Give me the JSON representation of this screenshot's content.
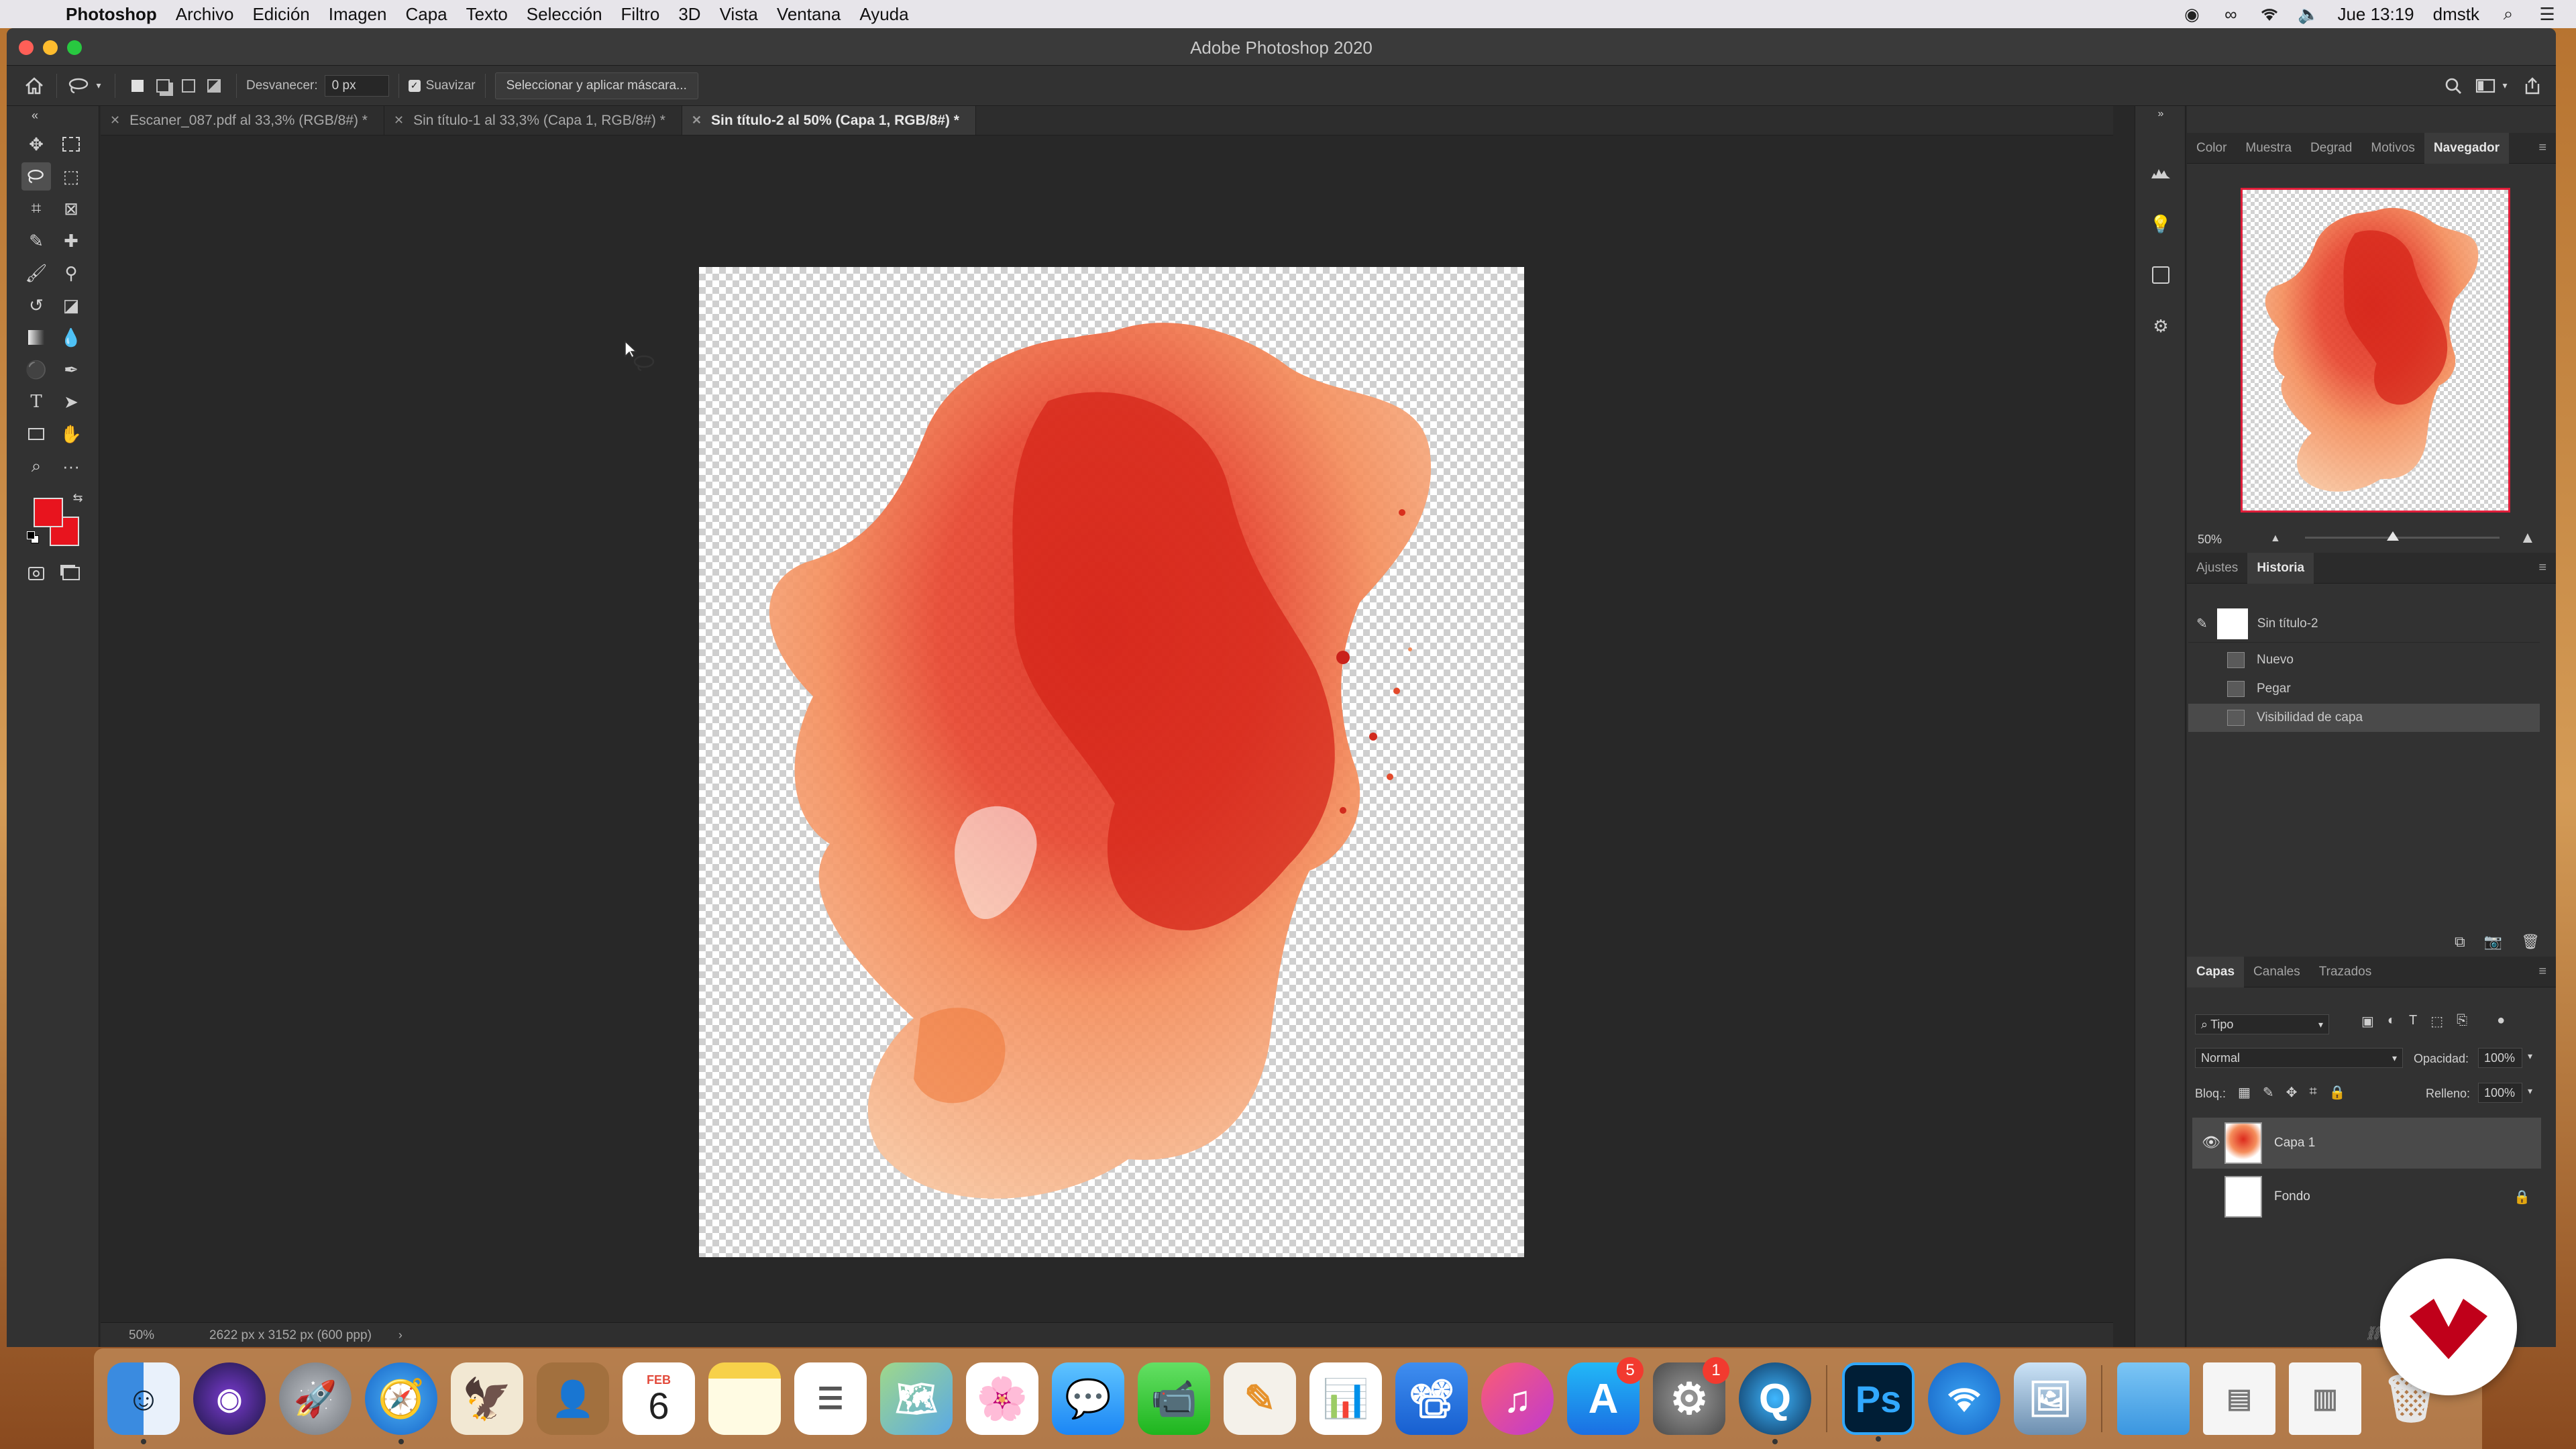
{
  "menubar": {
    "app_name": "Photoshop",
    "menus": [
      "Archivo",
      "Edición",
      "Imagen",
      "Capa",
      "Texto",
      "Selección",
      "Filtro",
      "3D",
      "Vista",
      "Ventana",
      "Ayuda"
    ],
    "clock": "Jue 13:19",
    "user": "dmstk"
  },
  "window": {
    "title": "Adobe Photoshop 2020"
  },
  "options_bar": {
    "feather_label": "Desvanecer:",
    "feather_value": "0 px",
    "smooth_label": "Suavizar",
    "smooth_checked": true,
    "mask_button": "Seleccionar y aplicar máscara..."
  },
  "tabs": [
    {
      "label": "Escaner_087.pdf al 33,3% (RGB/8#) *",
      "active": false
    },
    {
      "label": "Sin título-1 al 33,3% (Capa 1, RGB/8#) *",
      "active": false
    },
    {
      "label": "Sin título-2 al 50% (Capa 1, RGB/8#) *",
      "active": true
    }
  ],
  "colors": {
    "foreground": "#e8141e",
    "background": "#e8141e",
    "navigator_frame": "#e01e3a",
    "artwork_dark": "#dc2a1c",
    "artwork_light": "#f6b384"
  },
  "status": {
    "zoom": "50%",
    "doc_info": "2622 px x 3152 px (600 ppp)"
  },
  "navigator": {
    "tabs": [
      "Color",
      "Muestra",
      "Degrad",
      "Motivos",
      "Navegador"
    ],
    "active_tab": "Navegador",
    "zoom": "50%",
    "zoom_slider": 0.45
  },
  "history": {
    "tabs": [
      "Ajustes",
      "Historia"
    ],
    "active_tab": "Historia",
    "snapshot_label": "Sin título-2",
    "items": [
      {
        "label": "Nuevo",
        "selected": false
      },
      {
        "label": "Pegar",
        "selected": false
      },
      {
        "label": "Visibilidad de capa",
        "selected": true
      }
    ]
  },
  "layers": {
    "tabs": [
      "Capas",
      "Canales",
      "Trazados"
    ],
    "active_tab": "Capas",
    "filter_kind": "Tipo",
    "blend_mode": "Normal",
    "opacity_label": "Opacidad:",
    "opacity_value": "100%",
    "lock_label": "Bloq.:",
    "fill_label": "Relleno:",
    "fill_value": "100%",
    "items": [
      {
        "name": "Capa 1",
        "visible": true,
        "selected": true,
        "locked": false
      },
      {
        "name": "Fondo",
        "visible": false,
        "selected": false,
        "locked": true
      }
    ]
  },
  "dock": {
    "calendar_month": "FEB",
    "calendar_day": "6",
    "appstore_badge": "5",
    "prefs_badge": "1",
    "photoshop_label": "Ps"
  }
}
